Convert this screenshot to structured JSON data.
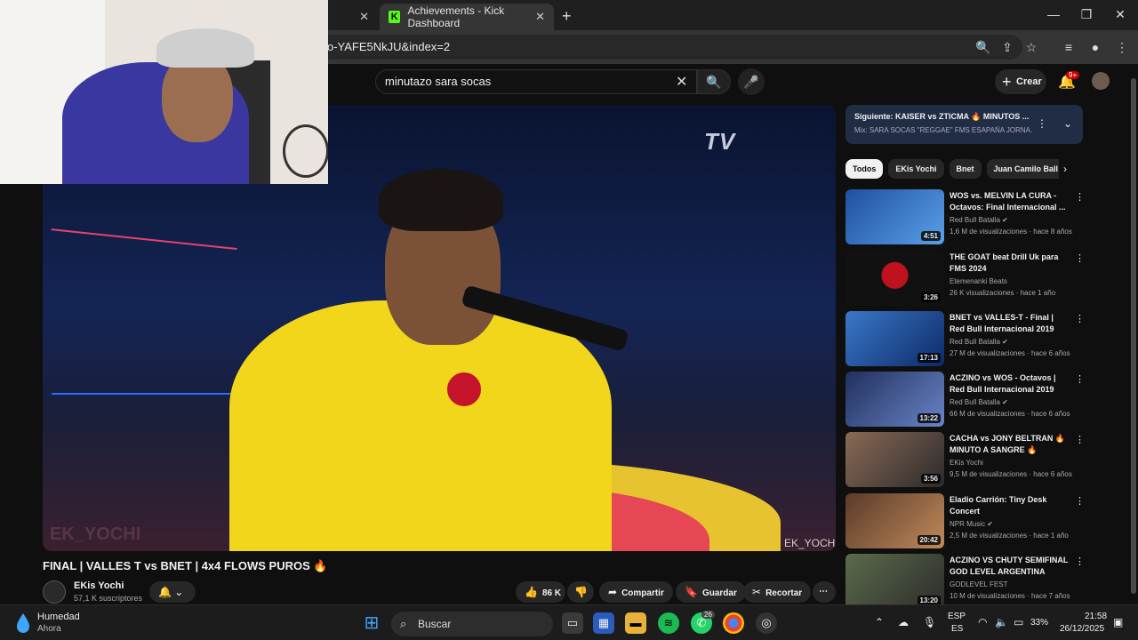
{
  "browser": {
    "active_tab_title": "Achievements - Kick Dashboard",
    "url_visible": "o-YAFE5NkJU&index=2"
  },
  "youtube": {
    "search_query": "minutazo sara socas",
    "create_label": "Crear",
    "notification_badge": "9+"
  },
  "video": {
    "title": "FINAL | VALLES T vs BNET | 4x4 FLOWS PUROS 🔥",
    "channel_name": "EKis Yochi",
    "subscribers": "57,1 K suscriptores",
    "likes": "86 K",
    "share_label": "Compartir",
    "save_label": "Guardar",
    "clip_label": "Recortar",
    "overlay_logo": "TV",
    "overlay_watermark": "EK_YOCHI"
  },
  "sidebar": {
    "next_up_title": "Siguiente: KAISER vs ZTICMA 🔥 MINUTOS ...",
    "next_up_sub": "Mix: SARA SOCAS \"REGGAE\" FMS ESAPAÑA JORNA...",
    "chips": [
      "Todos",
      "EKis Yochi",
      "Bnet",
      "Juan Camilo Ball"
    ],
    "recommendations": [
      {
        "title": "WOS vs. MELVIN LA CURA - Octavos: Final Internacional ...",
        "channel": "Red Bull Batalla ✔",
        "meta": "1,6 M de visualizaciones · hace 8 años",
        "duration": "4:51"
      },
      {
        "title": "THE GOAT beat Drill Uk para FMS 2024",
        "channel": "Etemenanki Beats",
        "meta": "26 K visualizaciones · hace 1 año",
        "duration": "3:26"
      },
      {
        "title": "BNET vs VALLES-T - Final | Red Bull Internacional 2019",
        "channel": "Red Bull Batalla ✔",
        "meta": "27 M de visualizaciones · hace 6 años",
        "duration": "17:13"
      },
      {
        "title": "ACZINO vs WOS - Octavos | Red Bull Internacional 2019",
        "channel": "Red Bull Batalla ✔",
        "meta": "66 M de visualizaciones · hace 6 años",
        "duration": "13:22"
      },
      {
        "title": "CACHA vs JONY BELTRAN 🔥 MINUTO A SANGRE 🔥",
        "channel": "EKis Yochi",
        "meta": "9,5 M de visualizaciones · hace 6 años",
        "duration": "3:56"
      },
      {
        "title": "Eladio Carrión: Tiny Desk Concert",
        "channel": "NPR Music ✔",
        "meta": "2,5 M de visualizaciones · hace 1 año",
        "duration": "20:42"
      },
      {
        "title": "ACZINO VS CHUTY   SEMIFINAL GOD LEVEL ARGENTINA",
        "channel": "GODLEVEL FEST",
        "meta": "10 M de visualizaciones · hace 7 años",
        "duration": "13:20"
      }
    ]
  },
  "taskbar": {
    "weather_title": "Humedad",
    "weather_sub": "Ahora",
    "search_label": "Buscar",
    "whatsapp_badge": "26",
    "lang_top": "ESP",
    "lang_bottom": "ES",
    "battery": "33%",
    "time": "21:58",
    "date": "26/12/2025"
  }
}
